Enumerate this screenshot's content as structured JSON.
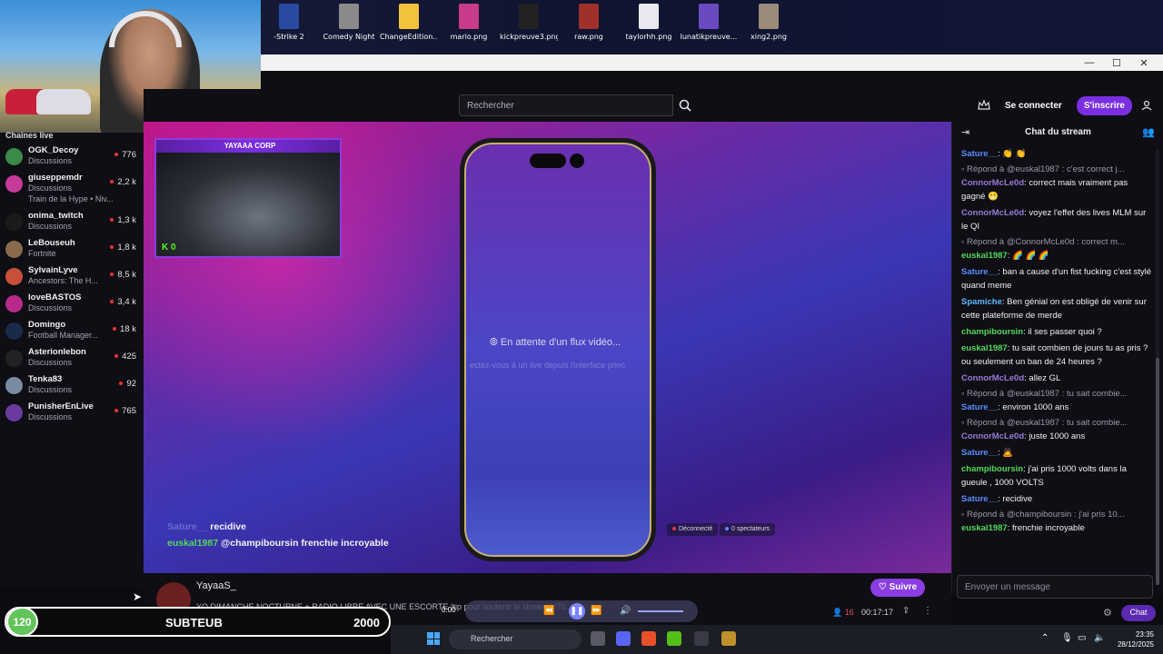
{
  "desktop": {
    "icons": [
      {
        "label": "-Strike 2",
        "color": "#2a4aa0"
      },
      {
        "label": "Comedy Night",
        "color": "#8a8a8a"
      },
      {
        "label": "ChangeEdition...",
        "color": "#f2c23a"
      },
      {
        "label": "mario.png",
        "color": "#c83a8a"
      },
      {
        "label": "kickpreuve3.png",
        "color": "#222222"
      },
      {
        "label": "raw.png",
        "color": "#a0302a"
      },
      {
        "label": "taylorhh.png",
        "color": "#e8e8f0"
      },
      {
        "label": "lunatikpreuve...",
        "color": "#6a4ac0"
      },
      {
        "label": "xing2.png",
        "color": "#9a8a7a"
      }
    ]
  },
  "window": {
    "minimize": "—",
    "maximize": "☐",
    "close": "✕"
  },
  "header": {
    "search_placeholder": "Rechercher",
    "login_label": "Se connecter",
    "signup_label": "S'inscrire"
  },
  "sidebar": {
    "title": "Chaînes live",
    "channels": [
      {
        "name": "OGK_Decoy",
        "category": "Discussions",
        "viewers": "776",
        "color": "#3a8a4a"
      },
      {
        "name": "giuseppemdr",
        "category": "Discussions",
        "viewers": "2,2 k",
        "color": "#c83a9a",
        "hype": "Train de la Hype • Niv..."
      },
      {
        "name": "onima_twitch",
        "category": "Discussions",
        "viewers": "1,3 k",
        "color": "#1a1a1a"
      },
      {
        "name": "LeBouseuh",
        "category": "Fortnite",
        "viewers": "1,8 k",
        "color": "#8a6a4a"
      },
      {
        "name": "SylvainLyve",
        "category": "Ancestors: The H...",
        "viewers": "8,5 k",
        "color": "#c8503a"
      },
      {
        "name": "loveBASTOS",
        "category": "Discussions",
        "viewers": "3,4 k",
        "color": "#b82a8a"
      },
      {
        "name": "Domingo",
        "category": "Football Manager...",
        "viewers": "18 k",
        "color": "#1a2a4a"
      },
      {
        "name": "Asterionlebon",
        "category": "Discussions",
        "viewers": "425",
        "color": "#222222"
      },
      {
        "name": "Tenka83",
        "category": "Discussions",
        "viewers": "92",
        "color": "#7a8aa0"
      },
      {
        "name": "PunisherEnLive",
        "category": "Discussions",
        "viewers": "765",
        "color": "#6a3aa0"
      }
    ]
  },
  "player": {
    "inset_banner": "YAYAAA CORP",
    "inset_kick_count": "0",
    "waiting_text": "En attente d'un flux vidéo...",
    "waiting_sub": "ectez-vous à un live depuis l'interface princ",
    "status_disconnected": "Déconnecté",
    "status_viewers": "0 spectateurs",
    "overlay_chat": [
      {
        "user": "Sature__",
        "text": "recidive",
        "user_color": "#6a6ad0"
      },
      {
        "user": "euskal1987",
        "text": "@champiboursin frenchie incroyable",
        "user_color": "#53d85a"
      }
    ]
  },
  "controls": {
    "streamer": "YayaaS_",
    "ticker": "YO DIMANCHE NOCTURNE + RADIO LIBRE AVEC UNE ESCORTE !tip pour soutenir le stream ! !70...",
    "follow_label": "Suivre",
    "time_start": "0:00",
    "viewers": "16",
    "elapsed": "00:17:17"
  },
  "chat": {
    "title": "Chat du stream",
    "input_placeholder": "Envoyer un message",
    "send_label": "Chat",
    "messages": [
      {
        "type": "msg",
        "user": "Sature__",
        "color": "#5b8cff",
        "text": "👏 👏"
      },
      {
        "type": "reply",
        "text": "Répond à @euskal1987 : c'est correct j..."
      },
      {
        "type": "msg",
        "user": "ConnorMcLe0d",
        "color": "#9a7ad8",
        "text": "correct mais vraiment pas gagné 😬"
      },
      {
        "type": "msg",
        "user": "ConnorMcLe0d",
        "color": "#9a7ad8",
        "text": "voyez l'effet des lives MLM sur le QI"
      },
      {
        "type": "reply",
        "text": "Répond à @ConnorMcLe0d : correct m..."
      },
      {
        "type": "msg",
        "user": "euskal1987",
        "color": "#53d85a",
        "text": "🌈 🌈 🌈"
      },
      {
        "type": "msg",
        "user": "Sature__",
        "color": "#5b8cff",
        "text": "ban a cause d'un fist fucking c'est stylé quand meme"
      },
      {
        "type": "msg",
        "user": "Spamiche",
        "color": "#5bb8ff",
        "text": "Ben génial on est obligé de venir sur cette plateforme de merde"
      },
      {
        "type": "msg",
        "user": "champiboursin",
        "color": "#53d85a",
        "text": "il ses passer quoi ?"
      },
      {
        "type": "msg",
        "user": "euskal1987",
        "color": "#53d85a",
        "text": "tu sait combien de jours tu as pris ? ou seulement un ban de 24 heures ?"
      },
      {
        "type": "msg",
        "user": "ConnorMcLe0d",
        "color": "#9a7ad8",
        "text": "allez GL"
      },
      {
        "type": "reply",
        "text": "Répond à @euskal1987 : tu sait combie..."
      },
      {
        "type": "msg",
        "user": "Sature__",
        "color": "#5b8cff",
        "text": "environ 1000 ans"
      },
      {
        "type": "reply",
        "text": "Répond à @euskal1987 : tu sait combie..."
      },
      {
        "type": "msg",
        "user": "ConnorMcLe0d",
        "color": "#9a7ad8",
        "text": "juste 1000 ans"
      },
      {
        "type": "msg",
        "user": "Sature__",
        "color": "#5b8cff",
        "text": "🙇"
      },
      {
        "type": "msg",
        "user": "champiboursin",
        "color": "#53d85a",
        "text": "j'ai pris 1000 volts dans la gueule , 1000 VOLTS"
      },
      {
        "type": "msg",
        "user": "Sature__",
        "color": "#5b8cff",
        "text": "recidive"
      },
      {
        "type": "reply",
        "text": "Répond à @champiboursin : j'ai pris 10..."
      },
      {
        "type": "msg",
        "user": "euskal1987",
        "color": "#53d85a",
        "text": "frenchie incroyable"
      }
    ]
  },
  "subgoal": {
    "count": "120",
    "label": "SUBTEUB",
    "goal": "2000"
  },
  "taskbar": {
    "search_label": "Rechercher",
    "time": "23:35",
    "date": "28/12/2025"
  }
}
